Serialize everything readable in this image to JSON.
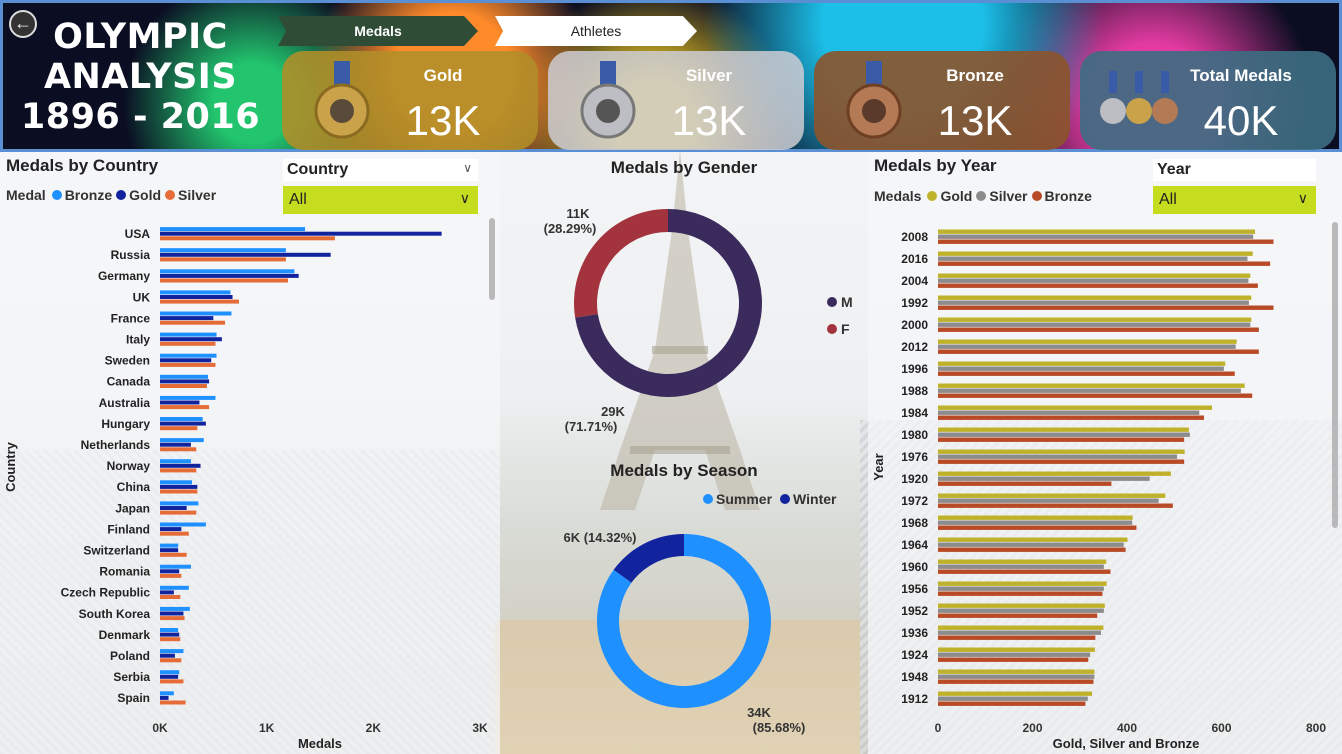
{
  "header": {
    "title_lines": [
      "OLYMPIC",
      "ANALYSIS",
      "1896 - 2016"
    ],
    "tabs": [
      {
        "label": "Medals"
      },
      {
        "label": "Athletes"
      }
    ],
    "kpis": [
      {
        "label": "Gold",
        "value": "13K",
        "color": "#b08e28"
      },
      {
        "label": "Silver",
        "value": "13K",
        "color": "#cdcdd4"
      },
      {
        "label": "Bronze",
        "value": "13K",
        "color": "#8c542c"
      },
      {
        "label": "Total Medals",
        "value": "40K",
        "color": "#3c6e82"
      }
    ]
  },
  "country_panel": {
    "title": "Medals by Country",
    "legend_title": "Medal",
    "legend": [
      {
        "name": "Bronze",
        "color": "#1e90ff"
      },
      {
        "name": "Gold",
        "color": "#12239e"
      },
      {
        "name": "Silver",
        "color": "#e66c37"
      }
    ],
    "slicer": {
      "label": "Country",
      "value": "All"
    }
  },
  "gender_panel": {
    "title": "Medals by Gender",
    "legend": [
      {
        "name": "M",
        "color": "#3b2a5c"
      },
      {
        "name": "F",
        "color": "#a3333d"
      }
    ],
    "labels": {
      "m": "29K",
      "m_pct": "(71.71%)",
      "f": "11K",
      "f_pct": "(28.29%)"
    }
  },
  "season_panel": {
    "title": "Medals by Season",
    "legend": [
      {
        "name": "Summer",
        "color": "#1e90ff"
      },
      {
        "name": "Winter",
        "color": "#12239e"
      }
    ],
    "labels": {
      "summer": "34K",
      "summer_pct": "(85.68%)",
      "winter": "6K (14.32%)"
    }
  },
  "year_panel": {
    "title": "Medals by Year",
    "legend_title": "Medals",
    "legend": [
      {
        "name": "Gold",
        "color": "#bfb22a"
      },
      {
        "name": "Silver",
        "color": "#8c8c8c"
      },
      {
        "name": "Bronze",
        "color": "#b84a25"
      }
    ],
    "slicer": {
      "label": "Year",
      "value": "All"
    }
  },
  "chart_data": [
    {
      "type": "bar",
      "orientation": "horizontal",
      "title": "Medals by Country",
      "xlabel": "Medals",
      "ylabel": "Country",
      "xlim": [
        0,
        3000
      ],
      "x_ticks": [
        "0K",
        "1K",
        "2K",
        "3K"
      ],
      "categories": [
        "USA",
        "Russia",
        "Germany",
        "UK",
        "France",
        "Italy",
        "Sweden",
        "Canada",
        "Australia",
        "Hungary",
        "Netherlands",
        "Norway",
        "China",
        "Japan",
        "Finland",
        "Switzerland",
        "Romania",
        "Czech Republic",
        "South Korea",
        "Denmark",
        "Poland",
        "Serbia",
        "Spain"
      ],
      "series": [
        {
          "name": "Bronze",
          "values": [
            1360,
            1180,
            1260,
            660,
            670,
            530,
            530,
            450,
            520,
            400,
            410,
            290,
            300,
            360,
            430,
            170,
            290,
            270,
            280,
            170,
            220,
            180,
            130
          ]
        },
        {
          "name": "Gold",
          "values": [
            2640,
            1600,
            1300,
            680,
            500,
            580,
            480,
            460,
            370,
            430,
            290,
            380,
            350,
            250,
            200,
            170,
            180,
            130,
            220,
            180,
            140,
            170,
            80
          ]
        },
        {
          "name": "Silver",
          "values": [
            1640,
            1180,
            1200,
            740,
            610,
            520,
            520,
            440,
            460,
            350,
            340,
            340,
            350,
            340,
            270,
            250,
            200,
            190,
            230,
            190,
            200,
            220,
            240
          ]
        }
      ]
    },
    {
      "type": "pie",
      "title": "Medals by Gender",
      "categories": [
        "M",
        "F"
      ],
      "values": [
        29000,
        11000
      ],
      "percentages": [
        71.71,
        28.29
      ]
    },
    {
      "type": "pie",
      "title": "Medals by Season",
      "categories": [
        "Summer",
        "Winter"
      ],
      "values": [
        34000,
        6000
      ],
      "percentages": [
        85.68,
        14.32
      ]
    },
    {
      "type": "bar",
      "orientation": "horizontal",
      "title": "Medals by Year",
      "xlabel": "Gold, Silver and Bronze",
      "ylabel": "Year",
      "xlim": [
        0,
        800
      ],
      "x_ticks": [
        "0",
        "200",
        "400",
        "600",
        "800"
      ],
      "categories": [
        "2008",
        "2016",
        "2004",
        "1992",
        "2000",
        "2012",
        "1996",
        "1988",
        "1984",
        "1980",
        "1976",
        "1920",
        "1972",
        "1968",
        "1964",
        "1960",
        "1956",
        "1952",
        "1936",
        "1924",
        "1948",
        "1912"
      ],
      "series": [
        {
          "name": "Gold",
          "values": [
            671,
            666,
            661,
            663,
            663,
            632,
            608,
            649,
            580,
            531,
            522,
            493,
            481,
            412,
            401,
            356,
            357,
            353,
            350,
            332,
            331,
            326
          ]
        },
        {
          "name": "Silver",
          "values": [
            667,
            655,
            657,
            658,
            661,
            630,
            605,
            641,
            553,
            533,
            506,
            448,
            467,
            411,
            393,
            351,
            351,
            351,
            345,
            322,
            331,
            317
          ]
        },
        {
          "name": "Bronze",
          "values": [
            710,
            703,
            677,
            710,
            679,
            679,
            628,
            665,
            563,
            521,
            521,
            367,
            497,
            420,
            397,
            365,
            348,
            337,
            333,
            318,
            329,
            312
          ]
        }
      ]
    }
  ]
}
